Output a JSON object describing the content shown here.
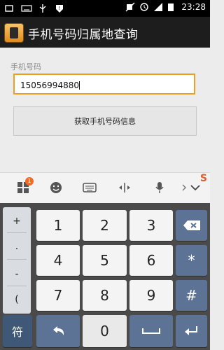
{
  "status_bar": {
    "time": "23:28"
  },
  "app": {
    "title": "手机号码归属地查询"
  },
  "form": {
    "phone_label": "手机号码",
    "phone_value": "15056994880",
    "query_button": "获取手机号码信息"
  },
  "keyboard": {
    "toolbar_badge": "1",
    "symbols": [
      "+",
      ".",
      "-",
      "("
    ],
    "digits": [
      "1",
      "2",
      "3",
      "4",
      "5",
      "6",
      "7",
      "8",
      "9"
    ],
    "star": "*",
    "hash": "#",
    "fu": "符",
    "zero": "0"
  },
  "colors": {
    "accent": "#f0a020",
    "key_blue": "#5c7395"
  }
}
